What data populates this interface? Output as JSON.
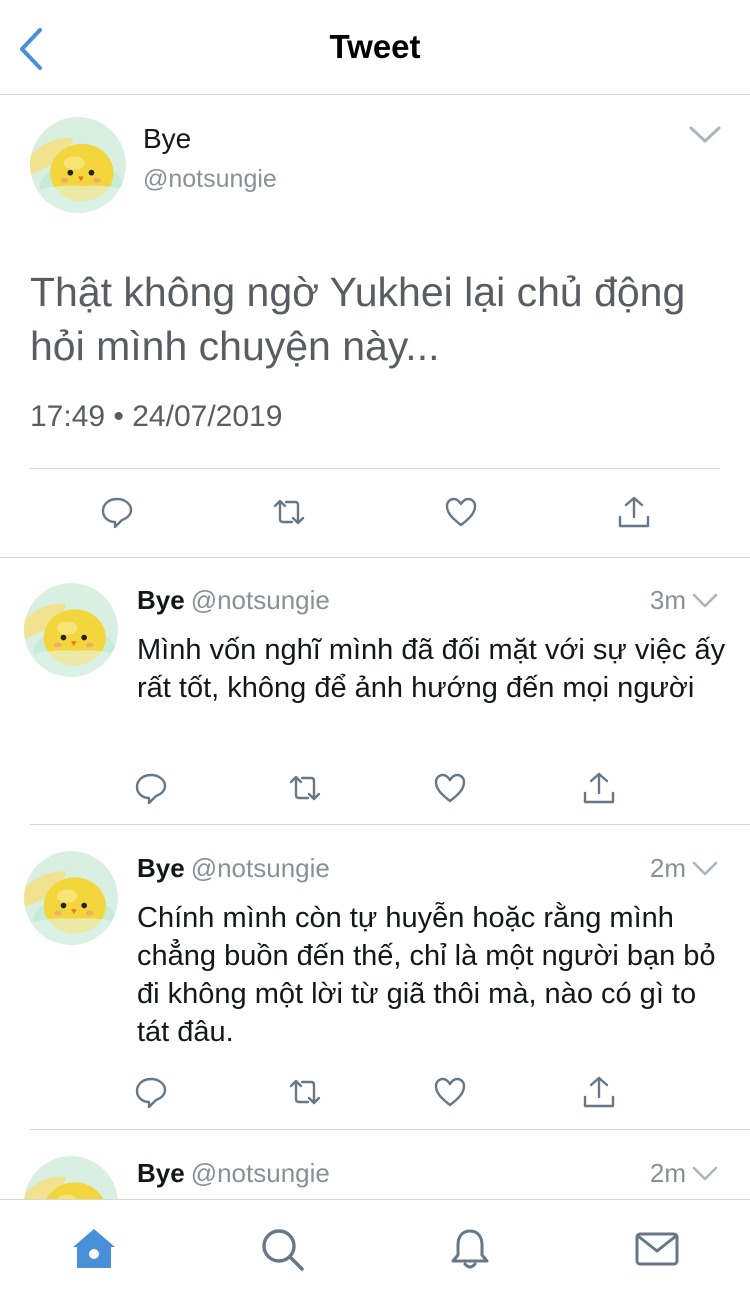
{
  "header": {
    "title": "Tweet",
    "back_icon": "chevron-left-icon"
  },
  "colors": {
    "accent": "#4a90d9",
    "text": "#14171a",
    "muted": "#8a9096",
    "icon": "#667788",
    "divider": "#d6d9dc"
  },
  "main_tweet": {
    "name": "Bye",
    "handle": "@notsungie",
    "text": "Thật không ngờ Yukhei lại chủ động hỏi mình chuyện này...",
    "timestamp": "17:49 • 24/07/2019",
    "actions": [
      "reply-icon",
      "retweet-icon",
      "like-icon",
      "share-icon"
    ]
  },
  "replies": [
    {
      "name": "Bye",
      "handle": "@notsungie",
      "time": "3m",
      "text": "Mình vốn nghĩ mình đã đối mặt với sự việc ấy rất tốt, không để ảnh hướng đến mọi người"
    },
    {
      "name": "Bye",
      "handle": "@notsungie",
      "time": "2m",
      "text": "Chính mình còn tự huyễn hoặc rằng mình chẳng buồn đến thế, chỉ là một người bạn bỏ đi không một lời từ giã thôi mà, nào có gì to tát đâu."
    },
    {
      "name": "Bye",
      "handle": "@notsungie",
      "time": "2m",
      "text": ""
    }
  ],
  "tabbar": {
    "items": [
      "home-icon",
      "search-icon",
      "notifications-icon",
      "messages-icon"
    ],
    "active": "home-icon"
  }
}
